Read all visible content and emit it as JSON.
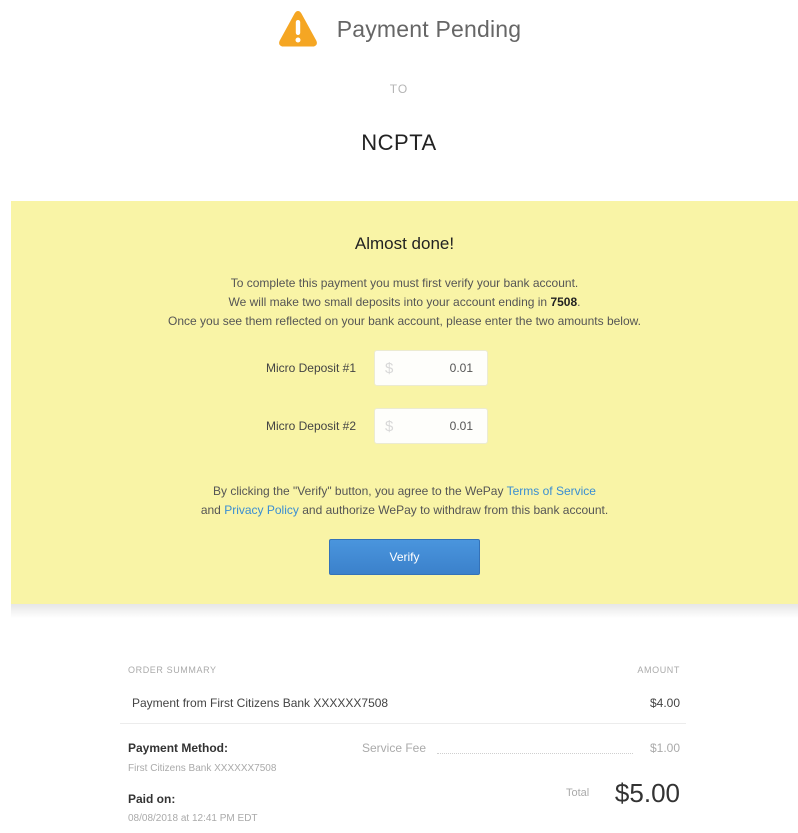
{
  "header": {
    "status_title": "Payment Pending",
    "to_label": "TO",
    "merchant": "NCPTA",
    "warning_color": "#f5a623"
  },
  "verify_panel": {
    "title": "Almost done!",
    "line1": "To complete this payment you must first verify your bank account.",
    "line2_prefix": "We will make two small deposits into your account ending in",
    "account_last4": "7508",
    "line3": "Once you see them reflected on your bank account, please enter the two amounts below.",
    "deposits": [
      {
        "label": "Micro Deposit #1",
        "currency": "$",
        "value": "0.01"
      },
      {
        "label": "Micro Deposit #2",
        "currency": "$",
        "value": "0.01"
      }
    ],
    "agree_prefix": "By clicking the \"Verify\" button, you agree to the WePay",
    "terms_link": "Terms of Service",
    "agree_and": "and",
    "privacy_link": "Privacy Policy",
    "agree_suffix": "and authorize WePay to withdraw from this bank account.",
    "verify_button": "Verify",
    "panel_color": "#f9f4a6",
    "button_color": "#3f88d3",
    "link_color": "#3a8ed2"
  },
  "summary": {
    "order_summary_label": "ORDER SUMMARY",
    "amount_label": "AMOUNT",
    "item_description": "Payment from First Citizens Bank XXXXXX7508",
    "item_amount": "$4.00",
    "payment_method_label": "Payment Method:",
    "payment_method_value": "First Citizens Bank XXXXXX7508",
    "service_fee_label": "Service Fee",
    "service_fee_amount": "$1.00",
    "paid_on_label": "Paid on:",
    "paid_on_value": "08/08/2018 at 12:41 PM EDT",
    "total_label": "Total",
    "total_amount": "$5.00"
  }
}
